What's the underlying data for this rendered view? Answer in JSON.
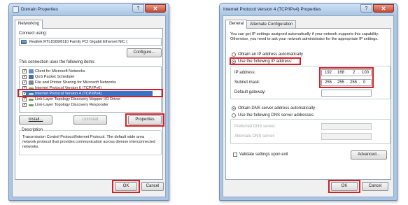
{
  "left": {
    "title": "Domain Properties",
    "help": "?",
    "close": "✕",
    "tab": "Networking",
    "connect_using": "Connect using:",
    "adapter": "Realtek RTL8169/8110 Family PCI Gigabit Ethernet NIC (",
    "configure": "Configure...",
    "items_label": "This connection uses the following items:",
    "items": [
      {
        "label": "Client for Microsoft Networks",
        "checked": "✓",
        "icon": "network-client-icon"
      },
      {
        "label": "QoS Packet Scheduler",
        "checked": "✓",
        "icon": "qos-icon"
      },
      {
        "label": "File and Printer Sharing for Microsoft Networks",
        "checked": "✓",
        "icon": "printer-sharing-icon"
      },
      {
        "label": "Internet Protocol Version 6 (TCP/IPv6)",
        "checked": "✓",
        "icon": "protocol-icon"
      },
      {
        "label": "Internet Protocol Version 4 (TCP/IPv4)",
        "checked": "✓",
        "icon": "protocol-icon"
      },
      {
        "label": "Link-Layer Topology Discovery Mapper I/O Driver",
        "checked": "✓",
        "icon": "protocol-icon"
      },
      {
        "label": "Link-Layer Topology Discovery Responder",
        "checked": "✓",
        "icon": "protocol-icon"
      }
    ],
    "install": "Install...",
    "uninstall": "Uninstall",
    "properties": "Properties",
    "description_title": "Description",
    "description": "Transmission Control Protocol/Internet Protocol. The default wide area network protocol that provides communication across diverse interconnected networks.",
    "ok": "OK",
    "cancel": "Cancel"
  },
  "right": {
    "title": "Internet Protocol Version 4 (TCP/IPv4) Properties",
    "help": "?",
    "close": "✕",
    "tabs": [
      "General",
      "Alternate Configuration"
    ],
    "intro": "You can get IP settings assigned automatically if your network supports this capability. Otherwise, you need to ask your network administrator for the appropriate IP settings.",
    "obtain_ip": "Obtain an IP address automatically",
    "use_ip": "Use the following IP address:",
    "ip_label": "IP address:",
    "ip_value": [
      "192",
      "168",
      "2",
      "100"
    ],
    "mask_label": "Subnet mask:",
    "mask_value": [
      "255",
      "255",
      "255",
      "0"
    ],
    "gateway_label": "Default gateway:",
    "obtain_dns": "Obtain DNS server address automatically",
    "use_dns": "Use the following DNS server addresses:",
    "preferred_dns": "Preferred DNS server:",
    "alternate_dns": "Alternate DNS server:",
    "validate": "Validate settings upon exit",
    "advanced": "Advanced...",
    "ok": "OK",
    "cancel": "Cancel",
    "dot": "."
  }
}
